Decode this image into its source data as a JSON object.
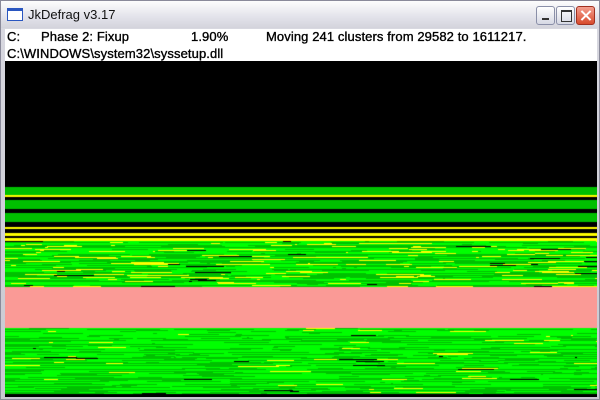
{
  "window": {
    "title": "JkDefrag v3.17",
    "minimize": "minimize",
    "maximize": "maximize",
    "close": "close"
  },
  "status": {
    "drive": "C:",
    "phase": "Phase 2: Fixup",
    "percent": "1.90%",
    "message": "Moving 241 clusters from 29582 to 1611217.",
    "file": "C:\\WINDOWS\\system32\\syssetup.dll",
    "progress_percent": 1.9
  },
  "colors": {
    "empty": "#000000",
    "fragmented": "#ffff00",
    "unfragmented": "#00c000",
    "unmovable": "#00ff00",
    "mft_reserved": "#fa9a96"
  }
}
